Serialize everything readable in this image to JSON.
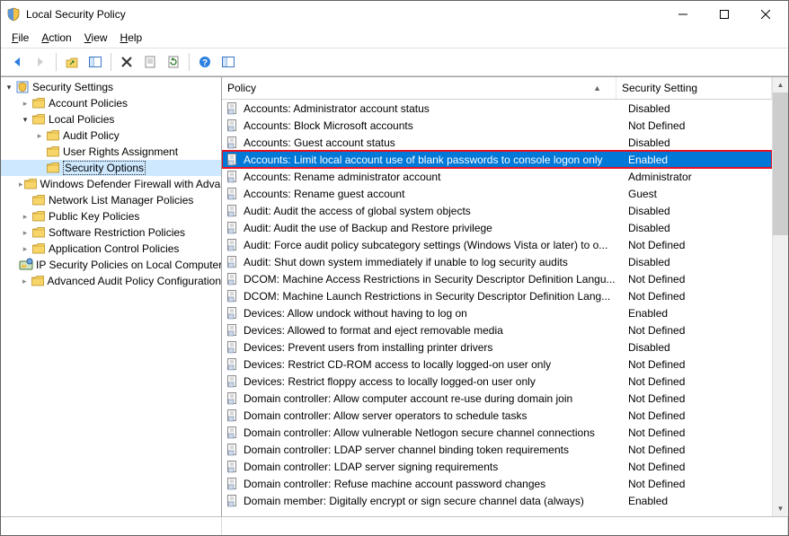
{
  "window": {
    "title": "Local Security Policy"
  },
  "menu": {
    "file": "File",
    "action": "Action",
    "view": "View",
    "help": "Help"
  },
  "tree": {
    "root": "Security Settings",
    "items": [
      {
        "label": "Account Policies",
        "has_children": true,
        "expanded": false,
        "depth": 1
      },
      {
        "label": "Local Policies",
        "has_children": true,
        "expanded": true,
        "depth": 1
      },
      {
        "label": "Audit Policy",
        "has_children": true,
        "expanded": false,
        "depth": 2
      },
      {
        "label": "User Rights Assignment",
        "has_children": false,
        "expanded": false,
        "depth": 2
      },
      {
        "label": "Security Options",
        "has_children": false,
        "expanded": false,
        "depth": 2,
        "selected": true
      },
      {
        "label": "Windows Defender Firewall with Advanced Security",
        "has_children": true,
        "expanded": false,
        "depth": 1
      },
      {
        "label": "Network List Manager Policies",
        "has_children": false,
        "expanded": false,
        "depth": 1
      },
      {
        "label": "Public Key Policies",
        "has_children": true,
        "expanded": false,
        "depth": 1
      },
      {
        "label": "Software Restriction Policies",
        "has_children": true,
        "expanded": false,
        "depth": 1
      },
      {
        "label": "Application Control Policies",
        "has_children": true,
        "expanded": false,
        "depth": 1
      },
      {
        "label": "IP Security Policies on Local Computer",
        "has_children": false,
        "expanded": false,
        "depth": 1,
        "special_icon": "ipsec"
      },
      {
        "label": "Advanced Audit Policy Configuration",
        "has_children": true,
        "expanded": false,
        "depth": 1
      }
    ]
  },
  "columns": {
    "policy": "Policy",
    "setting": "Security Setting"
  },
  "policies": [
    {
      "name": "Accounts: Administrator account status",
      "setting": "Disabled"
    },
    {
      "name": "Accounts: Block Microsoft accounts",
      "setting": "Not Defined"
    },
    {
      "name": "Accounts: Guest account status",
      "setting": "Disabled"
    },
    {
      "name": "Accounts: Limit local account use of blank passwords to console logon only",
      "setting": "Enabled",
      "selected": true
    },
    {
      "name": "Accounts: Rename administrator account",
      "setting": "Administrator"
    },
    {
      "name": "Accounts: Rename guest account",
      "setting": "Guest"
    },
    {
      "name": "Audit: Audit the access of global system objects",
      "setting": "Disabled"
    },
    {
      "name": "Audit: Audit the use of Backup and Restore privilege",
      "setting": "Disabled"
    },
    {
      "name": "Audit: Force audit policy subcategory settings (Windows Vista or later) to o...",
      "setting": "Not Defined"
    },
    {
      "name": "Audit: Shut down system immediately if unable to log security audits",
      "setting": "Disabled"
    },
    {
      "name": "DCOM: Machine Access Restrictions in Security Descriptor Definition Langu...",
      "setting": "Not Defined"
    },
    {
      "name": "DCOM: Machine Launch Restrictions in Security Descriptor Definition Lang...",
      "setting": "Not Defined"
    },
    {
      "name": "Devices: Allow undock without having to log on",
      "setting": "Enabled"
    },
    {
      "name": "Devices: Allowed to format and eject removable media",
      "setting": "Not Defined"
    },
    {
      "name": "Devices: Prevent users from installing printer drivers",
      "setting": "Disabled"
    },
    {
      "name": "Devices: Restrict CD-ROM access to locally logged-on user only",
      "setting": "Not Defined"
    },
    {
      "name": "Devices: Restrict floppy access to locally logged-on user only",
      "setting": "Not Defined"
    },
    {
      "name": "Domain controller: Allow computer account re-use during domain join",
      "setting": "Not Defined"
    },
    {
      "name": "Domain controller: Allow server operators to schedule tasks",
      "setting": "Not Defined"
    },
    {
      "name": "Domain controller: Allow vulnerable Netlogon secure channel connections",
      "setting": "Not Defined"
    },
    {
      "name": "Domain controller: LDAP server channel binding token requirements",
      "setting": "Not Defined"
    },
    {
      "name": "Domain controller: LDAP server signing requirements",
      "setting": "Not Defined"
    },
    {
      "name": "Domain controller: Refuse machine account password changes",
      "setting": "Not Defined"
    },
    {
      "name": "Domain member: Digitally encrypt or sign secure channel data (always)",
      "setting": "Enabled"
    }
  ]
}
